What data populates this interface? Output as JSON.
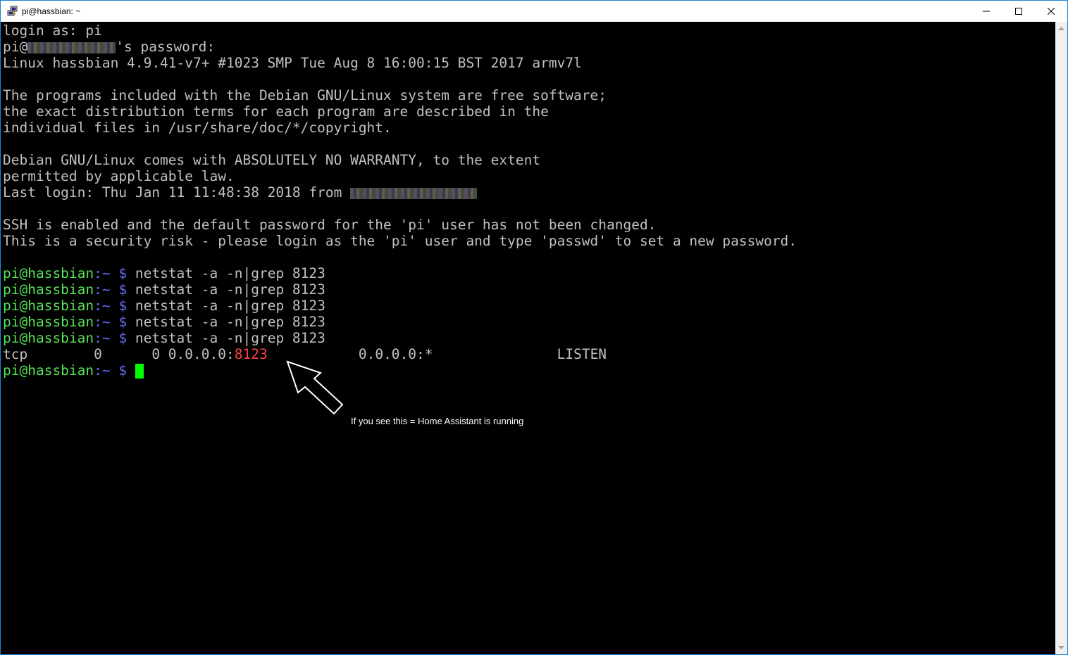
{
  "window": {
    "title": "pi@hassbian: ~"
  },
  "terminal": {
    "lines": [
      "login as: pi",
      "pi@",
      "'s password:",
      "Linux hassbian 4.9.41-v7+ #1023 SMP Tue Aug 8 16:00:15 BST 2017 armv7l",
      "The programs included with the Debian GNU/Linux system are free software;",
      "the exact distribution terms for each program are described in the",
      "individual files in /usr/share/doc/*/copyright.",
      "Debian GNU/Linux comes with ABSOLUTELY NO WARRANTY, to the extent",
      "permitted by applicable law.",
      "Last login: Thu Jan 11 11:48:38 2018 from ",
      "SSH is enabled and the default password for the 'pi' user has not been changed.",
      "This is a security risk - please login as the 'pi' user and type 'passwd' to set a new password."
    ],
    "prompt_user": "pi@hassbian",
    "prompt_sep": ":~",
    "prompt_symbol": " $ ",
    "command": "netstat -a -n|grep 8123",
    "output_prefix": "tcp        0      0 0.0.0.0:",
    "output_port": "8123",
    "output_suffix": "           0.0.0.0:*               LISTEN"
  },
  "annotation": {
    "text": "If you see this = Home Assistant is running"
  },
  "colors": {
    "prompt_user": "#55e255",
    "prompt_path": "#6b6bff",
    "port_highlight": "#ff4040",
    "cursor": "#00ff00"
  },
  "icons": [
    "putty-icon",
    "minimize-icon",
    "maximize-icon",
    "close-icon",
    "scroll-up-icon",
    "scroll-down-icon",
    "arrow-annotation-icon"
  ]
}
